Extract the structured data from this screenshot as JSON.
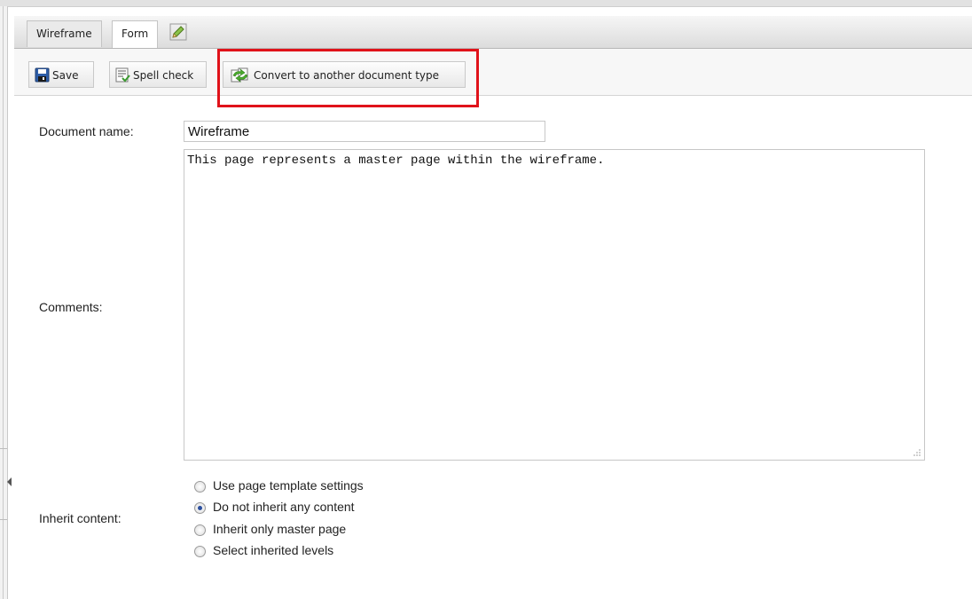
{
  "tabs": [
    {
      "label": "Wireframe",
      "active": false
    },
    {
      "label": "Form",
      "active": true
    }
  ],
  "toolbar": {
    "save_label": "Save",
    "spell_label": "Spell check",
    "convert_label": "Convert to another document type"
  },
  "form": {
    "document_name_label": "Document name:",
    "document_name_value": "Wireframe",
    "comments_label": "Comments:",
    "comments_value": "This page represents a master page within the wireframe.",
    "inherit_label": "Inherit content:",
    "inherit_options": [
      {
        "label": "Use page template settings",
        "selected": false
      },
      {
        "label": "Do not inherit any content",
        "selected": true
      },
      {
        "label": "Inherit only master page",
        "selected": false
      },
      {
        "label": "Select inherited levels",
        "selected": false
      }
    ]
  },
  "colors": {
    "highlight": "#e0121a",
    "radio_selected": "#2b4f9e"
  },
  "icons": [
    "pencil-icon",
    "save-icon",
    "spell-check-icon",
    "convert-icon",
    "resize-grip-icon",
    "collapse-arrow-icon"
  ]
}
